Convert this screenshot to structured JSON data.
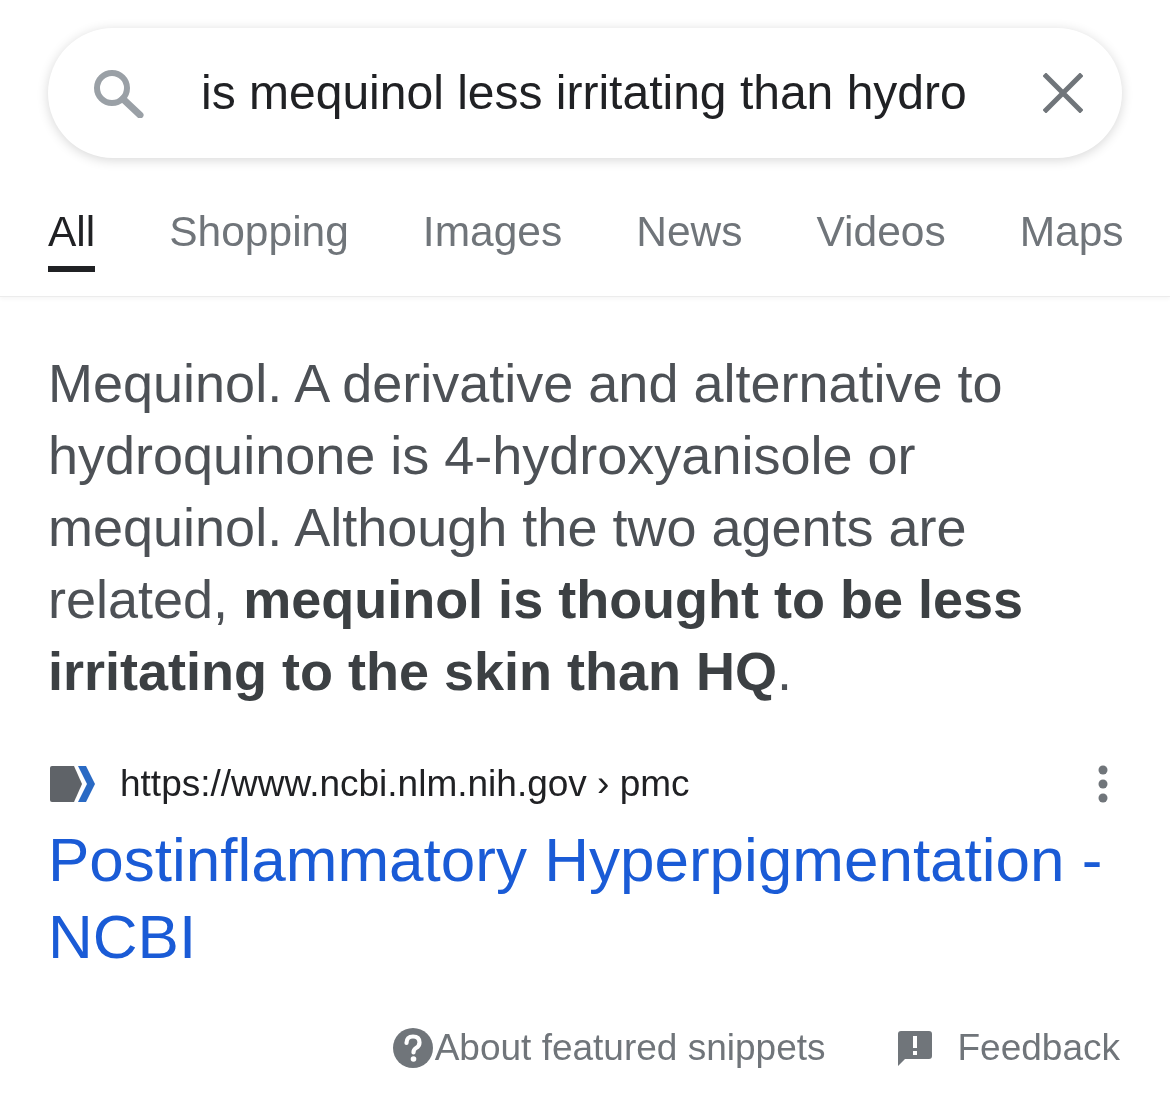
{
  "search": {
    "query": "is mequinol less irritating than hydro"
  },
  "tabs": [
    {
      "label": "All",
      "selected": true
    },
    {
      "label": "Shopping",
      "selected": false
    },
    {
      "label": "Images",
      "selected": false
    },
    {
      "label": "News",
      "selected": false
    },
    {
      "label": "Videos",
      "selected": false
    },
    {
      "label": "Maps",
      "selected": false
    }
  ],
  "featured_snippet": {
    "text": "Mequinol. A derivative and alternative to hydroquinone is 4-hydroxyanisole or mequinol. Although the two agents are related, **mequinol is thought to be less irritating to the skin than HQ**.",
    "source_url": "https://www.ncbi.nlm.nih.gov › pmc",
    "result_title": "Postinflammatory Hyperpigmentation - NCBI"
  },
  "footer": {
    "about_link": "About featured snippets",
    "feedback_link": "Feedback"
  }
}
